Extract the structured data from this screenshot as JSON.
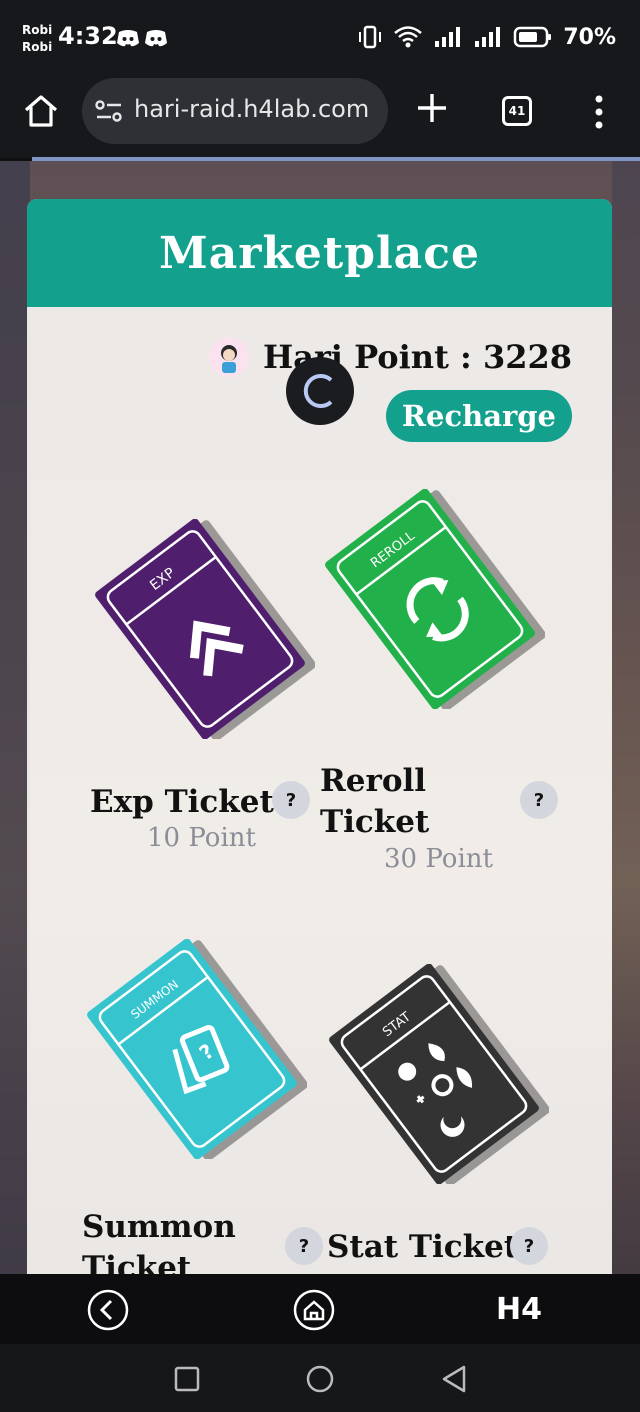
{
  "status_bar": {
    "carrier_1": "Robi",
    "carrier_2": "Robi",
    "time": "4:32",
    "battery": "70%"
  },
  "browser": {
    "url": "hari-raid.h4lab.com",
    "tab_count": "41"
  },
  "marketplace": {
    "title": "Marketplace",
    "points_label": "Hari Point : 3228",
    "recharge_label": "Recharge",
    "help_label": "?",
    "tickets": [
      {
        "name": "Exp Ticket",
        "price": "10 Point",
        "label": "EXP",
        "color": "#4f1f6e"
      },
      {
        "name": "Reroll Ticket",
        "price": "30 Point",
        "label": "REROLL",
        "color": "#22b04b"
      },
      {
        "name": "Summon Ticket",
        "price": "",
        "label": "SUMMON",
        "color": "#36c4cf"
      },
      {
        "name": "Stat Ticket",
        "price": "",
        "label": "STAT",
        "color": "#333333"
      }
    ]
  },
  "app_nav": {
    "logo": "H4"
  },
  "colors": {
    "accent": "#13a08d",
    "browser_bg": "#17181c"
  }
}
